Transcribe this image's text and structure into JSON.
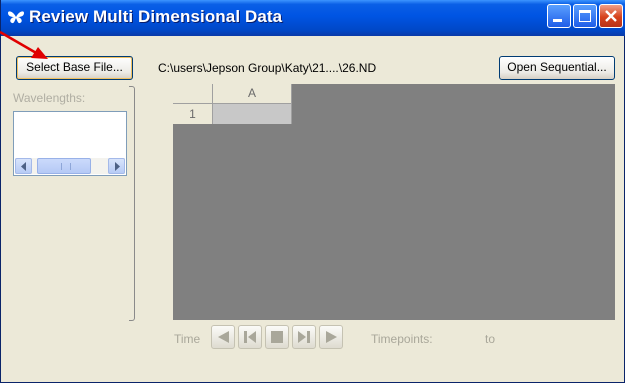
{
  "window": {
    "title": "Review Multi Dimensional Data"
  },
  "toolbar": {
    "select_base_file_label": "Select Base File...",
    "file_path": "C:\\users\\Jepson Group\\Katy\\21....\\26.ND",
    "open_sequential_label": "Open Sequential..."
  },
  "wavelengths": {
    "label": "Wavelengths:"
  },
  "grid": {
    "column_headers": [
      "A"
    ],
    "row_headers": [
      "1"
    ]
  },
  "playback": {
    "time_label": "Time",
    "timepoints_label": "Timepoints:",
    "to_label": "to"
  },
  "icons": {
    "app": "butterfly-icon",
    "first": "first-frame-icon",
    "step_back": "step-back-icon",
    "stop": "stop-icon",
    "step_forward": "step-forward-icon",
    "play": "play-icon"
  },
  "colors": {
    "titlebar": "#0054e3",
    "close_button": "#d6421c",
    "window_bg": "#ece9d8",
    "grid_bg": "#808080",
    "annotation_arrow": "#e00000"
  }
}
